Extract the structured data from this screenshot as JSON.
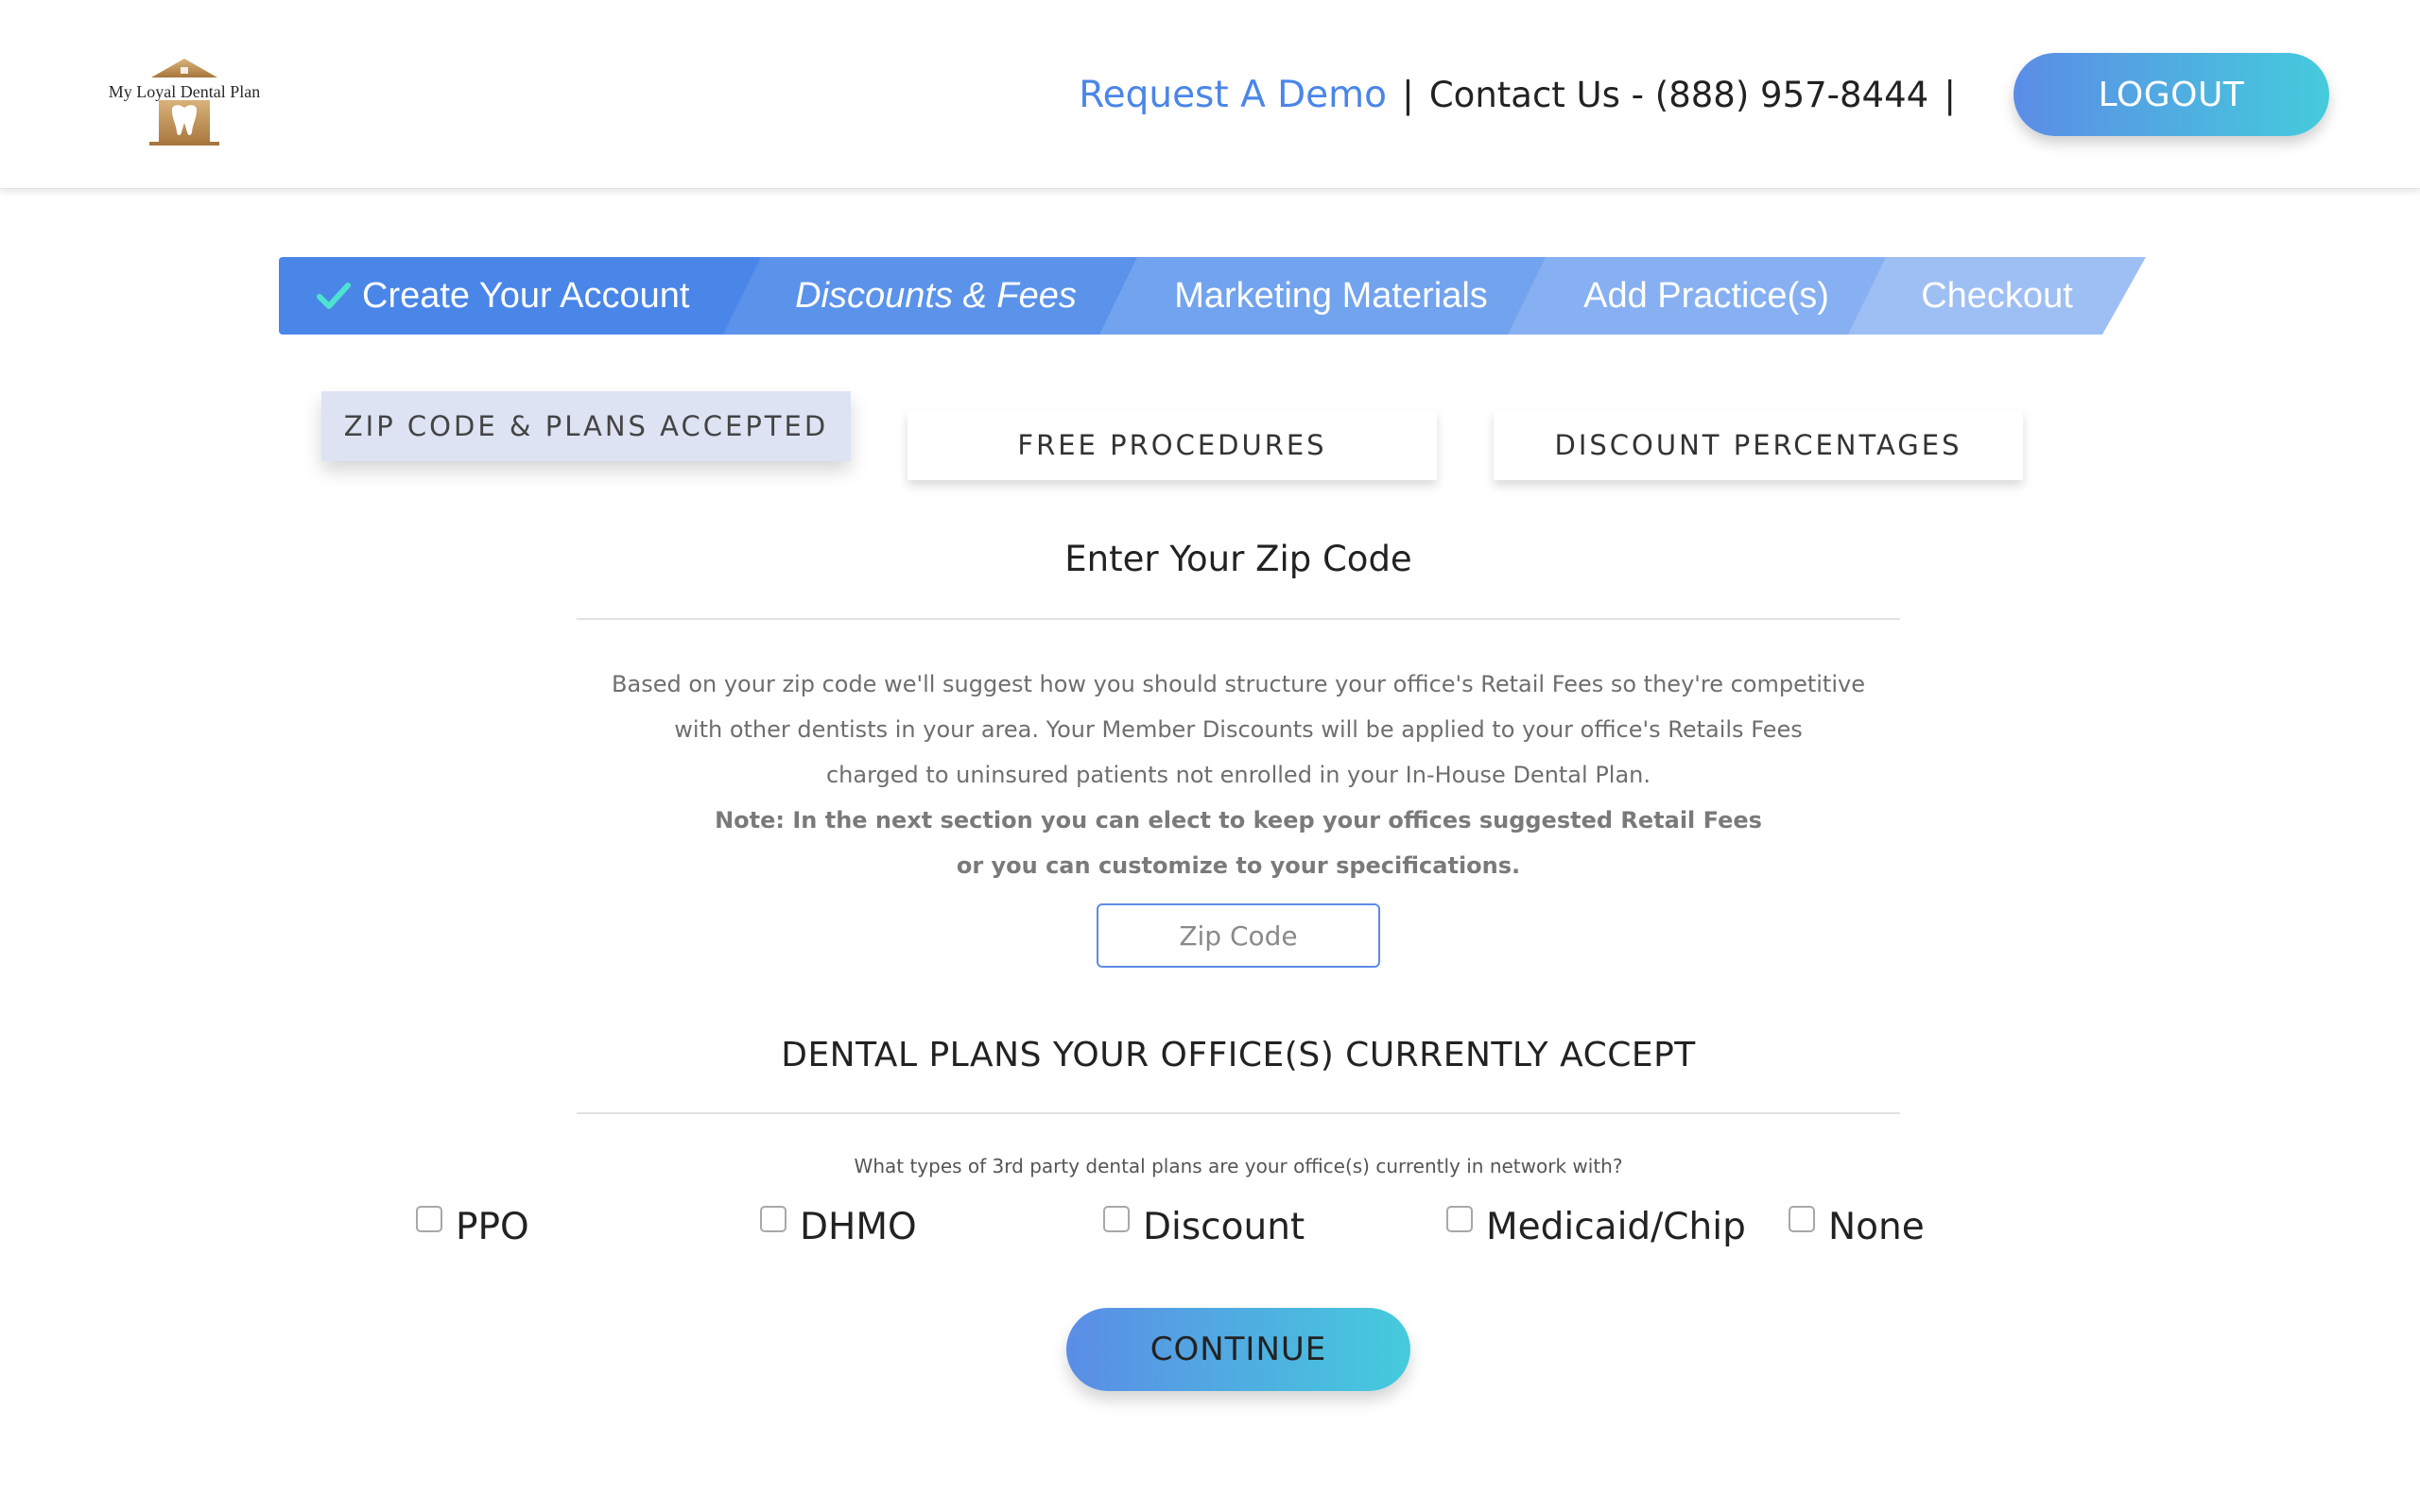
{
  "header": {
    "logo_text": "My Loyal Dental Plan",
    "request_demo": "Request A Demo",
    "separator": "|",
    "contact": "Contact Us - (888) 957-8444",
    "logout": "LOGOUT"
  },
  "steps": [
    {
      "label": "Create Your Account",
      "state": "completed"
    },
    {
      "label": "Discounts & Fees",
      "state": "current"
    },
    {
      "label": "Marketing Materials",
      "state": "pending"
    },
    {
      "label": "Add Practice(s)",
      "state": "pending"
    },
    {
      "label": "Checkout",
      "state": "pending"
    }
  ],
  "subtabs": [
    {
      "label": "ZIP CODE & PLANS ACCEPTED",
      "active": true
    },
    {
      "label": "FREE PROCEDURES",
      "active": false
    },
    {
      "label": "DISCOUNT PERCENTAGES",
      "active": false
    }
  ],
  "zip": {
    "title": "Enter Your Zip Code",
    "desc_line1": "Based on your zip code we'll suggest how you should structure your office's Retail Fees so they're competitive",
    "desc_line2": "with other dentists in your area. Your Member Discounts will be applied to your office's Retails Fees",
    "desc_line3": "charged to uninsured patients not enrolled in your In-House Dental Plan.",
    "note_line1": "Note: In the next section you can elect to keep your offices suggested Retail Fees",
    "note_line2": "or you can customize to your specifications.",
    "placeholder": "Zip Code",
    "value": ""
  },
  "plans": {
    "title": "DENTAL PLANS YOUR OFFICE(S) CURRENTLY ACCEPT",
    "question": "What types of 3rd party dental plans are your office(s) currently in network with?",
    "options": [
      {
        "label": "PPO",
        "checked": false
      },
      {
        "label": "DHMO",
        "checked": false
      },
      {
        "label": "Discount",
        "checked": false
      },
      {
        "label": "Medicaid/Chip",
        "checked": false
      },
      {
        "label": "None",
        "checked": false
      }
    ]
  },
  "continue": "CONTINUE",
  "colors": {
    "accent": "#4a86e8",
    "gradient_start": "#5b8de6",
    "gradient_end": "#45cbdc",
    "active_subtab": "#dde3f3",
    "check": "#4ee3d0"
  }
}
